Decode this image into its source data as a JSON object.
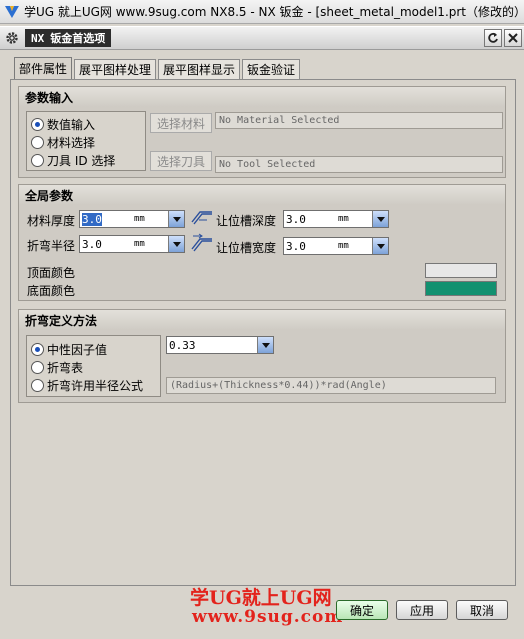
{
  "window": {
    "title": "学UG 就上UG网  www.9sug.com NX8.5 - NX 钣金 - [sheet_metal_model1.prt（修改的）"
  },
  "dialog": {
    "badge": "NX",
    "title": "钣金首选项"
  },
  "tabs": [
    "部件属性",
    "展平图样处理",
    "展平图样显示",
    "钣金验证"
  ],
  "param_input": {
    "title": "参数输入",
    "options": [
      "数值输入",
      "材料选择",
      "刀具 ID 选择"
    ],
    "selected_index": 0,
    "select_material_label": "选择材料",
    "select_tool_label": "选择刀具",
    "material_value": "No Material Selected",
    "tool_value": "No Tool Selected"
  },
  "global_params": {
    "title": "全局参数",
    "material_thickness": {
      "label": "材料厚度",
      "value": "3.0",
      "unit": "mm"
    },
    "bend_radius": {
      "label": "折弯半径",
      "value": "3.0",
      "unit": "mm"
    },
    "relief_depth": {
      "label": "让位槽深度",
      "value": "3.0",
      "unit": "mm"
    },
    "relief_width": {
      "label": "让位槽宽度",
      "value": "3.0",
      "unit": "mm"
    },
    "top_color_label": "顶面颜色",
    "bottom_color_label": "底面颜色",
    "top_color": "#e7e7e7",
    "bottom_color": "#129170"
  },
  "bend_method": {
    "title": "折弯定义方法",
    "options": [
      "中性因子值",
      "折弯表",
      "折弯许用半径公式"
    ],
    "selected_index": 0,
    "k_factor_value": "0.33",
    "formula": "(Radius+(Thickness*0.44))*rad(Angle)"
  },
  "buttons": {
    "ok": "确定",
    "apply": "应用",
    "cancel": "取消"
  },
  "watermark": {
    "line1": "学UG就上UG网",
    "line2": "www.9sug.com"
  }
}
